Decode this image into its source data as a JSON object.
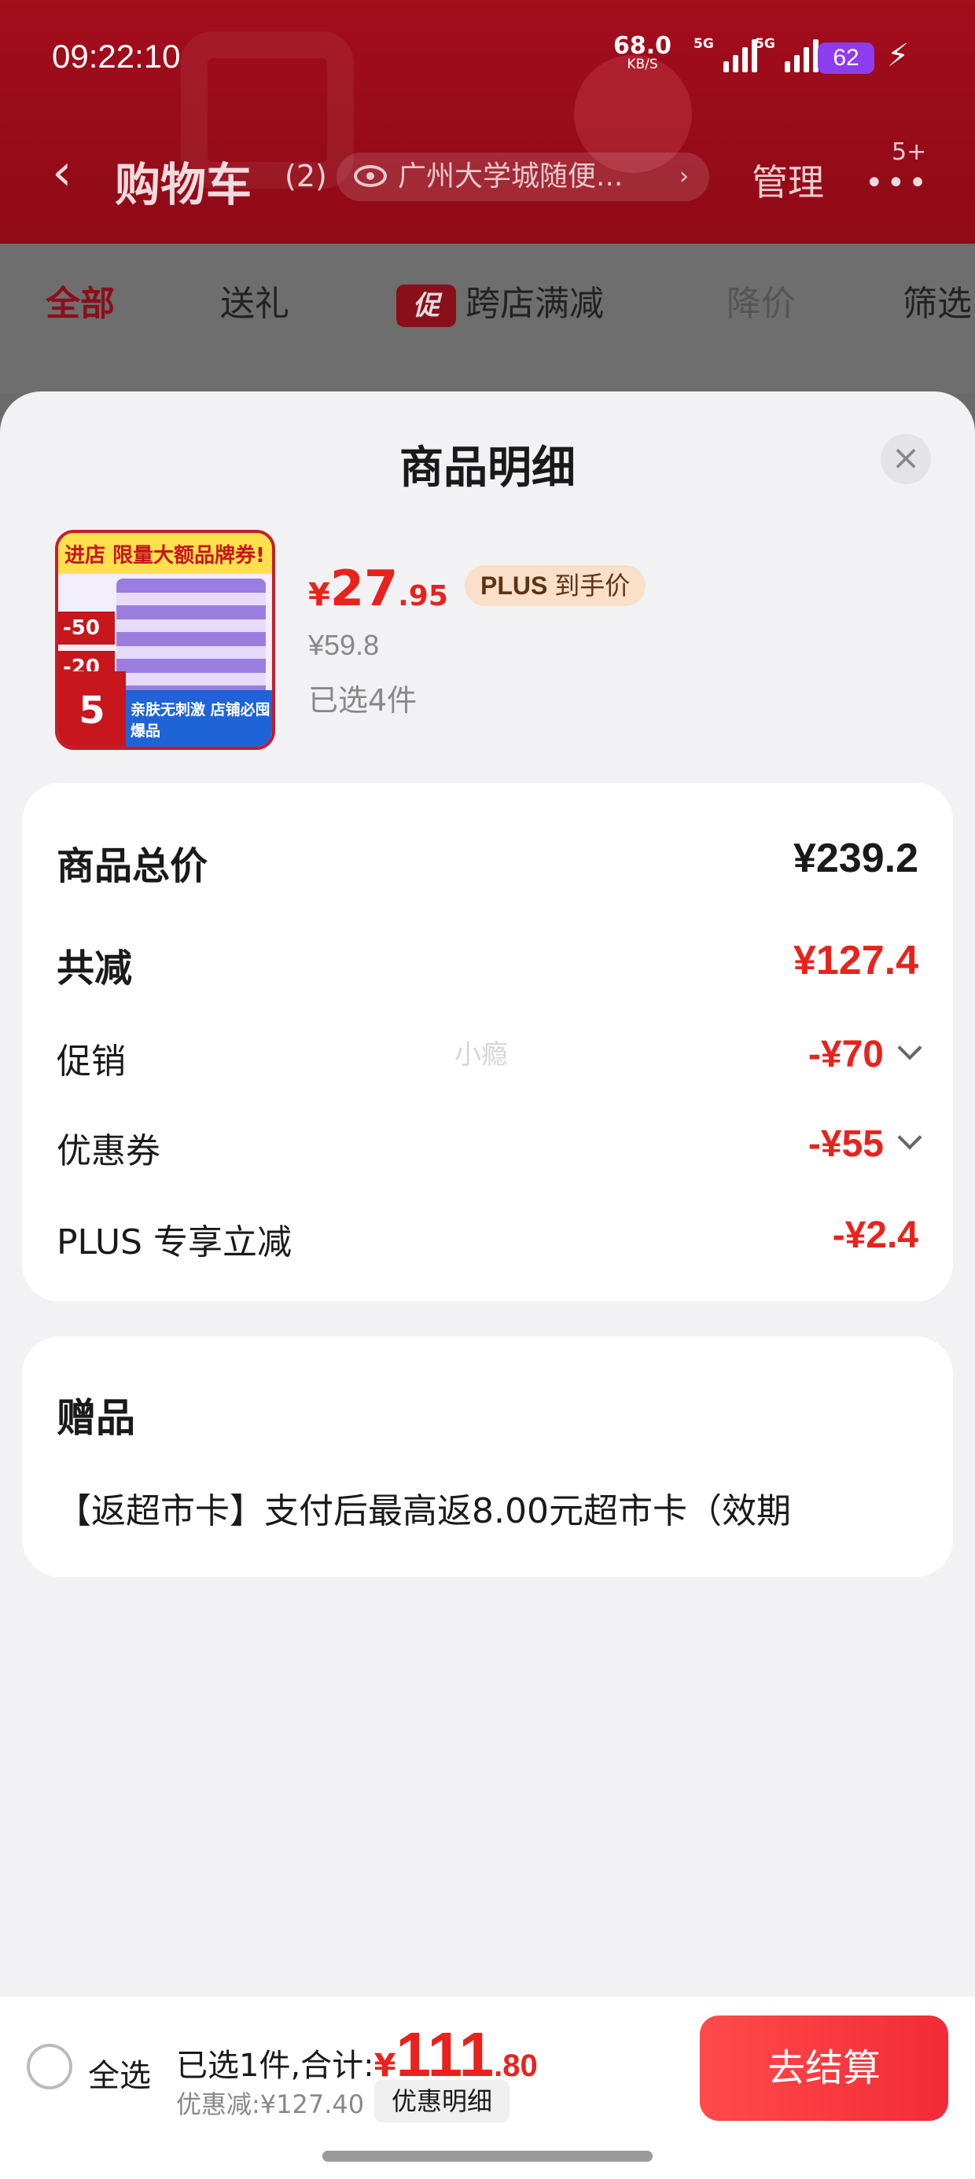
{
  "status_bar": {
    "time": "09:22:10",
    "net_speed": "68.0",
    "net_unit": "KB/S",
    "sim1": "5G",
    "sim2": "5G",
    "battery": "62"
  },
  "nav": {
    "back_icon": "chevron-left-icon",
    "title": "购物车",
    "count": "(2)",
    "location": "广州大学城随便...",
    "manage": "管理",
    "more_icon": "more-dots-icon",
    "more_badge": "5+"
  },
  "tabs": [
    {
      "label": "全部",
      "active": true
    },
    {
      "label": "送礼"
    },
    {
      "label": "跨店满减",
      "badge": "促"
    },
    {
      "label": "降价"
    },
    {
      "label": "筛选"
    }
  ],
  "sheet": {
    "title": "商品明细",
    "close_icon": "close-icon",
    "product": {
      "price_symbol": "¥",
      "price_int": "27",
      "price_dec": ".95",
      "plus_badge_brand": "PLUS",
      "plus_badge_text": "到手价",
      "original_price": "¥59.8",
      "selected_qty": "已选4件",
      "thumb_text_top": "进店 限量大额品牌券!",
      "thumb_text_a": "-50",
      "thumb_text_b": "-20",
      "thumb_text_c": "5",
      "thumb_text_bottom": "亲肤无刺激 店铺必囤爆品"
    },
    "price_breakdown": {
      "total_label": "商品总价",
      "total_value": "¥239.2",
      "reduce_label": "共减",
      "reduce_value": "¥127.4",
      "promo_label": "促销",
      "promo_value": "-¥70",
      "coupon_label": "优惠券",
      "coupon_value": "-¥55",
      "plus_label": "PLUS 专享立减",
      "plus_value": "-¥2.4",
      "watermark": "小瘾"
    },
    "gift": {
      "title": "赠品",
      "text": "【返超市卡】支付后最高返8.00元超市卡（效期"
    }
  },
  "bottom_bar": {
    "select_all": "全选",
    "summary_text": "已选1件,合计:",
    "total_symbol": "¥",
    "total_int": "111",
    "total_dec": ".80",
    "discount_text": "优惠减:¥127.40",
    "detail_chip": "优惠明细",
    "checkout": "去结算"
  },
  "colors": {
    "brand_red": "#e8231d",
    "header_red": "#a30d1c",
    "plus_badge_bg": "#fbe0c9"
  }
}
